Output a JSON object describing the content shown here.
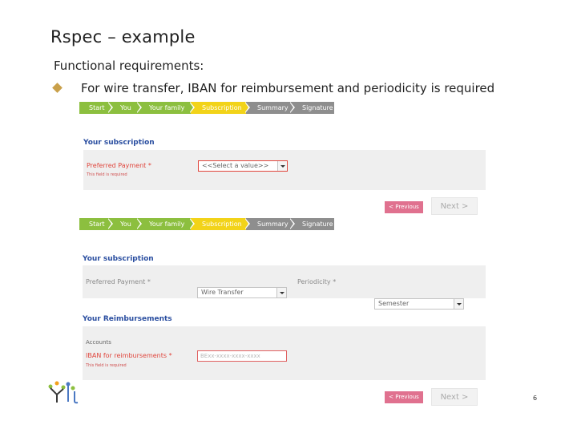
{
  "slide": {
    "title": "Rspec – example",
    "subtitle": "Functional requirements:",
    "bullet": "For wire transfer, IBAN for reimbursement and periodicity is required",
    "page_number": "6"
  },
  "colors": {
    "step_done": "#8cbf3f",
    "step_active": "#f2d319",
    "step_todo": "#8e8e8e",
    "link_blue": "#2a4ea0",
    "error_red": "#e0453c",
    "prev_pink": "#e0718f"
  },
  "steps": [
    "Start",
    "You",
    "Your family",
    "Subscription",
    "Summary",
    "Signature"
  ],
  "form1": {
    "section_title": "Your subscription",
    "payment_label": "Preferred Payment *",
    "payment_value": "<<Select a value>>",
    "hint": "This field is required",
    "prev_label": "< Previous",
    "next_label": "Next >"
  },
  "form2": {
    "section_title": "Your subscription",
    "payment_label": "Preferred Payment *",
    "payment_value": "Wire Transfer",
    "periodicity_label": "Periodicity *",
    "periodicity_value": "Semester",
    "reimb_title": "Your Reimbursements",
    "accounts_label": "Accounts",
    "iban_label": "IBAN for reimbursements *",
    "iban_placeholder": "BExx-xxxx-xxxx-xxxx",
    "hint": "This field is required",
    "prev_label": "< Previous",
    "next_label": "Next >"
  }
}
